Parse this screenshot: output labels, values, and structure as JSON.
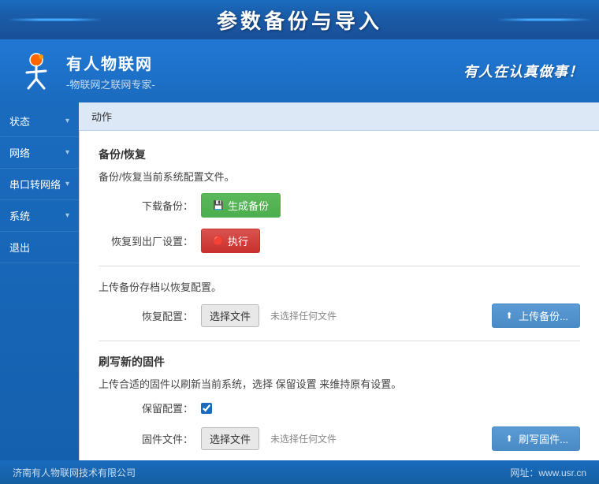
{
  "header": {
    "title": "参数备份与导入"
  },
  "brand": {
    "name": "有人物联网",
    "subtitle": "-物联网之联网专家-",
    "slogan": "有人在认真做事！"
  },
  "sidebar": {
    "items": [
      {
        "label": "状态",
        "arrow": "▾"
      },
      {
        "label": "网络",
        "arrow": "▾"
      },
      {
        "label": "串口转网络",
        "arrow": "▾"
      },
      {
        "label": "系统",
        "arrow": "▾"
      },
      {
        "label": "退出",
        "arrow": ""
      }
    ]
  },
  "toolbar": {
    "label": "动作"
  },
  "backup_section": {
    "title": "备份/恢复",
    "desc": "备份/恢复当前系统配置文件。",
    "download_label": "下载备份：",
    "backup_btn": "生成备份",
    "restore_label": "恢复到出厂设置：",
    "restore_btn": "执行"
  },
  "upload_section": {
    "desc": "上传备份存档以恢复配置。",
    "restore_config_label": "恢复配置：",
    "choose_file_btn": "选择文件",
    "no_file_hint": "未选择任何文件",
    "upload_btn": "上传备份..."
  },
  "firmware_section": {
    "title": "刷写新的固件",
    "desc": "上传合适的固件以刷新当前系统，选择 保留设置 来维持原有设置。",
    "keep_config_label": "保留配置：",
    "firmware_label": "固件文件：",
    "choose_file_btn": "选择文件",
    "no_file_hint": "未选择任何文件",
    "flash_btn": "刷写固件..."
  },
  "footer": {
    "company": "济南有人物联网技术有限公司",
    "website_label": "网址：www.usr.cn"
  }
}
